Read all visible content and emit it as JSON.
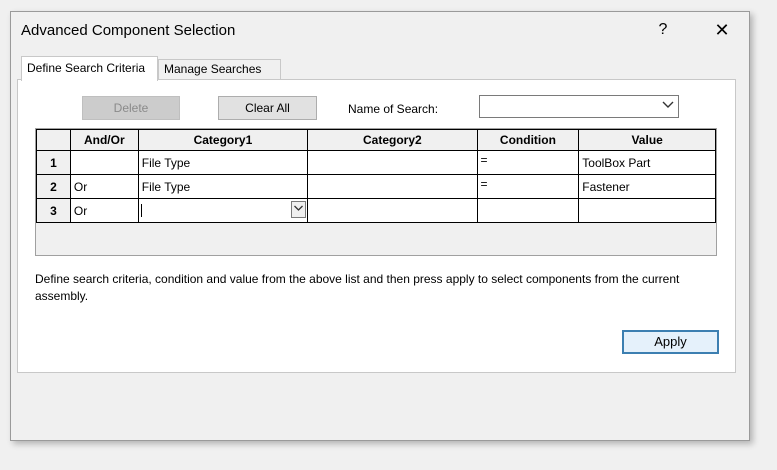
{
  "window": {
    "title": "Advanced Component Selection",
    "help_glyph": "?",
    "close_glyph": "✕"
  },
  "tabs": [
    {
      "label": "Define Search Criteria"
    },
    {
      "label": "Manage Searches"
    }
  ],
  "toolbar": {
    "delete_label": "Delete",
    "clear_all_label": "Clear All",
    "name_of_search_label": "Name of Search:",
    "name_of_search_value": ""
  },
  "grid": {
    "headers": [
      "And/Or",
      "Category1",
      "Category2",
      "Condition",
      "Value"
    ],
    "rows": [
      {
        "num": "1",
        "and_or": "",
        "category1": "File Type",
        "category2": "",
        "condition": "=",
        "value": "ToolBox Part"
      },
      {
        "num": "2",
        "and_or": "Or",
        "category1": "File Type",
        "category2": "",
        "condition": "=",
        "value": "Fastener"
      },
      {
        "num": "3",
        "and_or": "Or",
        "category1": "",
        "category2": "",
        "condition": "",
        "value": ""
      }
    ]
  },
  "description": "Define search criteria, condition and value from the above list and then press apply to select components from the current assembly.",
  "apply_label": "Apply",
  "icons": {
    "dropdown": "chevron-down-icon",
    "help": "help-icon",
    "close": "close-icon"
  }
}
